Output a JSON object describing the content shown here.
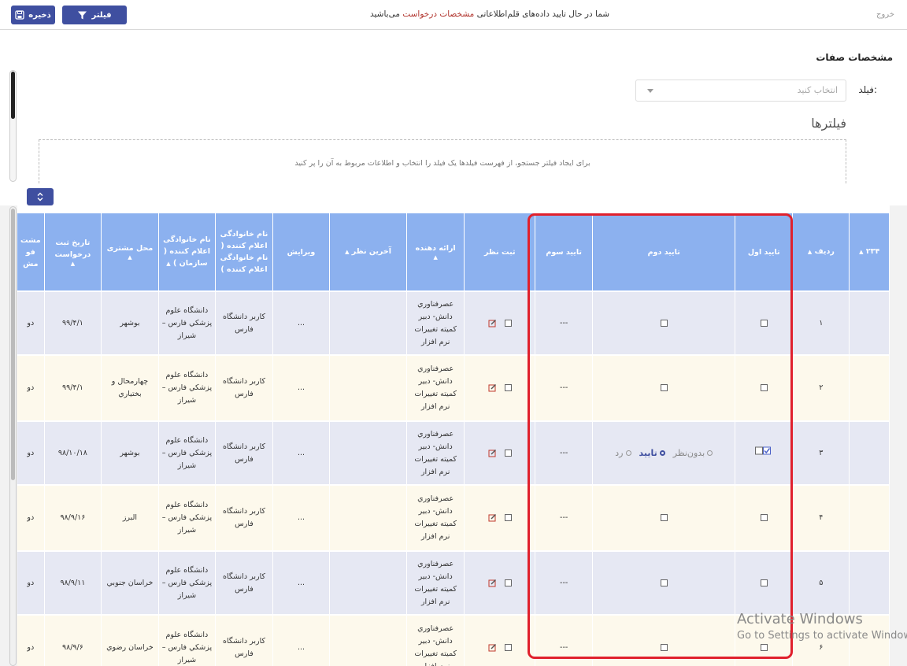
{
  "topbar": {
    "exit_label": "خروج",
    "notice_prefix": "شما در حال تایید داده‌های قلم‌اطلاعاتی",
    "notice_highlight": "مشخصات درخواست",
    "notice_suffix": "می‌باشید",
    "filter_label": "فیلتر",
    "save_label": "ذخیره"
  },
  "section": {
    "title": "مشخصات صفات",
    "field_label": "فیلد:",
    "field_placeholder": "انتخاب کنید",
    "filters_title": "فیلترها",
    "filters_hint": "برای ایجاد فیلتر جستجو، از فهرست فیلدها یک فیلد را انتخاب و اطلاعات مربوط به آن را پر کنید"
  },
  "grid": {
    "headers": {
      "count": "۲۳۴",
      "row_no": "ردیف",
      "first_approval": "تایید اول",
      "second_approval": "تایید دوم",
      "third_approval": "تایید سوم",
      "register_opinion": "ثبت نظر",
      "provider": "ارائه دهنده",
      "last_opinion": "آخرین نظر",
      "edit": "ویرایش",
      "reporter_family": "نام خانوادگی اعلام کننده ( نام خانوادگی اعلام کننده )",
      "reporter_org": "نام خانوادگی اعلام کننده ( سازمان )",
      "customer_location": "محل مشتری",
      "request_date": "تاریخ ثبت درخواست",
      "cut_col": "مشت فو مش"
    },
    "approval_options": [
      "بدون‌نظر",
      "تایید",
      "رد"
    ],
    "rows": [
      {
        "no": "۱",
        "third": "---",
        "provider": "عصرفناوري دانش- دبير كميته تغييرات نرم افزار",
        "edit": "...",
        "family": "كاربر دانشگاه فارس",
        "org": "دانشگاه علوم پزشكي فارس – شيراز",
        "location": "بوشهر",
        "date": "۹۹/۴/۱",
        "cut": "دو"
      },
      {
        "no": "۲",
        "third": "---",
        "provider": "عصرفناوري دانش- دبير كميته تغييرات نرم افزار",
        "edit": "...",
        "family": "كاربر دانشگاه فارس",
        "org": "دانشگاه علوم پزشكي فارس – شيراز",
        "location": "چهارمحال و بختياري",
        "date": "۹۹/۴/۱",
        "cut": "دو"
      },
      {
        "no": "۳",
        "third": "---",
        "provider": "عصرفناوري دانش- دبير كميته تغييرات نرم افزار",
        "edit": "...",
        "family": "كاربر دانشگاه فارس",
        "org": "دانشگاه علوم پزشكي فارس – شيراز",
        "location": "بوشهر",
        "date": "۹۸/۱۰/۱۸",
        "cut": "دو"
      },
      {
        "no": "۴",
        "third": "---",
        "provider": "عصرفناوري دانش- دبير كميته تغييرات نرم افزار",
        "edit": "...",
        "family": "كاربر دانشگاه فارس",
        "org": "دانشگاه علوم پزشكي فارس – شيراز",
        "location": "البرز",
        "date": "۹۸/۹/۱۶",
        "cut": "دو"
      },
      {
        "no": "۵",
        "third": "---",
        "provider": "عصرفناوري دانش- دبير كميته تغييرات نرم افزار",
        "edit": "...",
        "family": "كاربر دانشگاه فارس",
        "org": "دانشگاه علوم پزشكي فارس – شيراز",
        "location": "خراسان جنوبي",
        "date": "۹۸/۹/۱۱",
        "cut": "دو"
      },
      {
        "no": "۶",
        "third": "---",
        "provider": "عصرفناوري دانش- دبير كميته تغييرات نرم افزار",
        "edit": "...",
        "family": "كاربر دانشگاه فارس",
        "org": "دانشگاه علوم پزشكي فارس – شيراز",
        "location": "خراسان رضوي",
        "date": "۹۸/۹/۶",
        "cut": "دو"
      }
    ]
  },
  "watermark": {
    "line1": "Activate Windows",
    "line2": "Go to Settings to activate Windows."
  },
  "colors": {
    "primary": "#3f4fa0",
    "header_bg": "#8cb1ef",
    "highlight_red": "#e0202c"
  }
}
